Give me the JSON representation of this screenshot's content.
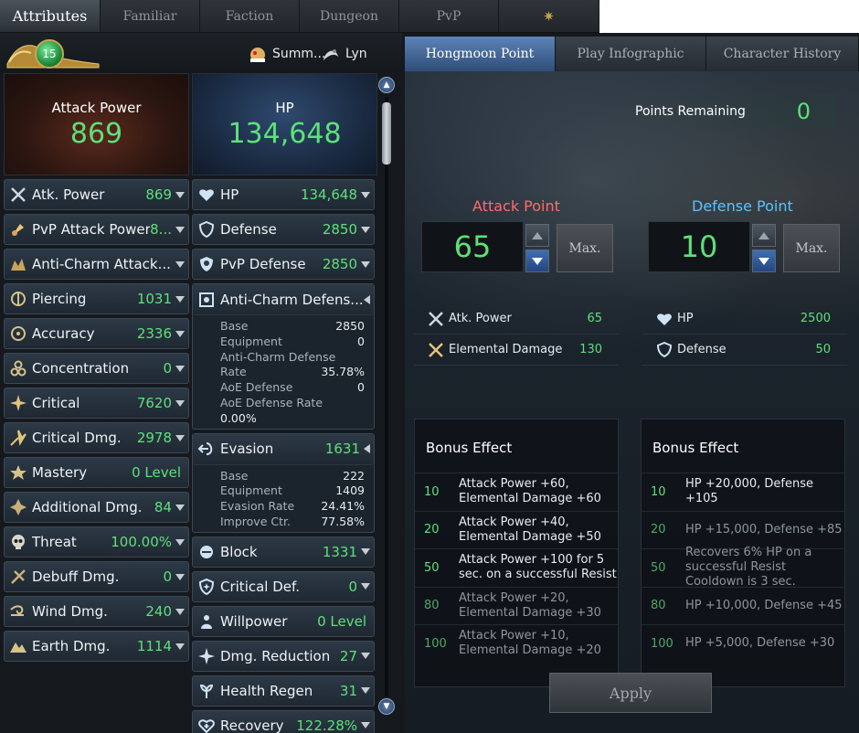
{
  "top_tabs": [
    {
      "label": "Attributes",
      "active": true
    },
    {
      "label": "Familiar"
    },
    {
      "label": "Faction"
    },
    {
      "label": "Dungeon"
    },
    {
      "label": "PvP"
    },
    {
      "label": "",
      "icon": "compass-star-icon"
    }
  ],
  "character": {
    "level": "15",
    "summon_name": "Summ...",
    "class_name": "Lyn"
  },
  "attack_hero": {
    "title": "Attack Power",
    "value": "869"
  },
  "hp_hero": {
    "title": "HP",
    "value": "134,648"
  },
  "left_stats": [
    {
      "label": "Atk. Power",
      "value": "869",
      "icon": "swords-icon"
    },
    {
      "label": "PvP Attack Power",
      "value": "8...",
      "icon": "pvp-attack-icon"
    },
    {
      "label": "Anti-Charm Attack...",
      "value": "",
      "icon": "anti-charm-icon"
    },
    {
      "label": "Piercing",
      "value": "1031",
      "icon": "piercing-icon"
    },
    {
      "label": "Accuracy",
      "value": "2336",
      "icon": "accuracy-icon"
    },
    {
      "label": "Concentration",
      "value": "0",
      "icon": "concentration-icon"
    },
    {
      "label": "Critical",
      "value": "7620",
      "icon": "critical-icon"
    },
    {
      "label": "Critical Dmg.",
      "value": "2978",
      "icon": "critical-dmg-icon"
    },
    {
      "label": "Mastery",
      "value": "0 Level",
      "icon": "mastery-icon"
    },
    {
      "label": "Additional Dmg.",
      "value": "84",
      "icon": "additional-dmg-icon"
    },
    {
      "label": "Threat",
      "value": "100.00%",
      "icon": "skull-icon"
    },
    {
      "label": "Debuff Dmg.",
      "value": "0",
      "icon": "debuff-icon"
    },
    {
      "label": "Wind Dmg.",
      "value": "240",
      "icon": "wind-icon"
    },
    {
      "label": "Earth Dmg.",
      "value": "1114",
      "icon": "earth-icon"
    }
  ],
  "right_stats_top": [
    {
      "label": "HP",
      "value": "134,648",
      "icon": "heart-icon"
    },
    {
      "label": "Defense",
      "value": "2850",
      "icon": "shield-icon"
    },
    {
      "label": "PvP Defense",
      "value": "2850",
      "icon": "pvp-defense-icon"
    }
  ],
  "anti_charm_defense": {
    "label": "Anti-Charm Defens...",
    "rows": [
      {
        "k": "Base",
        "v": "2850"
      },
      {
        "k": "Equipment",
        "v": "0"
      },
      {
        "k": "Anti-Charm Defense",
        "v": ""
      },
      {
        "k": "Rate",
        "v": "35.78%"
      },
      {
        "k": "AoE Defense",
        "v": "0"
      },
      {
        "k": "AoE Defense Rate",
        "v": ""
      },
      {
        "k": "0.00%",
        "v": ""
      }
    ]
  },
  "evasion": {
    "label": "Evasion",
    "value": "1631",
    "rows": [
      {
        "k": "Base",
        "v": "222"
      },
      {
        "k": "Equipment",
        "v": "1409"
      },
      {
        "k": "Evasion Rate",
        "v": "24.41%"
      },
      {
        "k": "Improve Ctr.",
        "v": "77.58%"
      }
    ]
  },
  "right_stats_bottom": [
    {
      "label": "Block",
      "value": "1331",
      "icon": "block-icon"
    },
    {
      "label": "Critical Def.",
      "value": "0",
      "icon": "critical-def-icon"
    },
    {
      "label": "Willpower",
      "value": "0 Level",
      "icon": "willpower-icon"
    },
    {
      "label": "Dmg. Reduction",
      "value": "27",
      "icon": "dmg-reduction-icon"
    },
    {
      "label": "Health Regen",
      "value": "31",
      "icon": "health-regen-icon"
    },
    {
      "label": "Recovery",
      "value": "122.28%",
      "icon": "recovery-icon"
    }
  ],
  "right_tabs": [
    {
      "label": "Hongmoon Point",
      "active": true
    },
    {
      "label": "Play Infographic"
    },
    {
      "label": "Character History"
    }
  ],
  "points_remaining": {
    "label": "Points Remaining",
    "value": "0"
  },
  "attack_point": {
    "title": "Attack Point",
    "value": "65",
    "max_label": "Max.",
    "gains": [
      {
        "label": "Atk. Power",
        "value": "65"
      },
      {
        "label": "Elemental Damage",
        "value": "130"
      }
    ],
    "bonus_title": "Bonus Effect",
    "bonus": [
      {
        "level": "10",
        "text": "Attack Power +60,\nElemental Damage +60",
        "active": true
      },
      {
        "level": "20",
        "text": "Attack Power +40,\nElemental Damage +50",
        "active": true
      },
      {
        "level": "50",
        "text": "Attack Power +100 for 5\nsec. on a successful Resist",
        "active": true
      },
      {
        "level": "80",
        "text": "Attack Power +20,\nElemental Damage +30",
        "active": false
      },
      {
        "level": "100",
        "text": "Attack Power +10,\nElemental Damage +20",
        "active": false
      }
    ]
  },
  "defense_point": {
    "title": "Defense Point",
    "value": "10",
    "max_label": "Max.",
    "gains": [
      {
        "label": "HP",
        "value": "2500"
      },
      {
        "label": "Defense",
        "value": "50"
      }
    ],
    "bonus_title": "Bonus Effect",
    "bonus": [
      {
        "level": "10",
        "text": "HP +20,000, Defense +105",
        "active": true
      },
      {
        "level": "20",
        "text": "HP +15,000, Defense +85",
        "active": false
      },
      {
        "level": "50",
        "text": "Recovers 6% HP on a\nsuccessful Resist\nCooldown is 3 sec.",
        "active": false
      },
      {
        "level": "80",
        "text": "HP +10,000, Defense +45",
        "active": false
      },
      {
        "level": "100",
        "text": "HP +5,000, Defense +30",
        "active": false
      }
    ]
  },
  "apply_label": "Apply",
  "colors": {
    "value_green": "#5ee07a",
    "attack_red": "#ff6b6b",
    "defense_blue": "#5bc2ff"
  }
}
